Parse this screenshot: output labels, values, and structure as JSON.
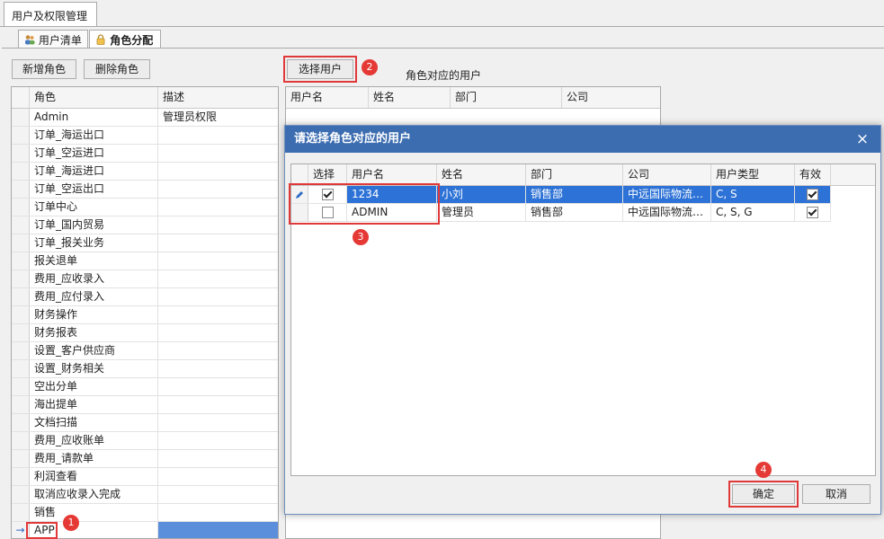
{
  "window": {
    "tab_title": "用户及权限管理"
  },
  "subtabs": [
    {
      "label": "用户清单",
      "icon": "users-icon"
    },
    {
      "label": "角色分配",
      "icon": "lock-icon"
    }
  ],
  "left": {
    "add_role": "新增角色",
    "delete_role": "删除角色",
    "columns": [
      "角色",
      "描述"
    ],
    "roles": [
      {
        "name": "Admin",
        "desc": "管理员权限"
      },
      {
        "name": "订单_海运出口",
        "desc": ""
      },
      {
        "name": "订单_空运进口",
        "desc": ""
      },
      {
        "name": "订单_海运进口",
        "desc": ""
      },
      {
        "name": "订单_空运出口",
        "desc": ""
      },
      {
        "name": "订单中心",
        "desc": ""
      },
      {
        "name": "订单_国内贸易",
        "desc": ""
      },
      {
        "name": "订单_报关业务",
        "desc": ""
      },
      {
        "name": "报关退单",
        "desc": ""
      },
      {
        "name": "费用_应收录入",
        "desc": ""
      },
      {
        "name": "费用_应付录入",
        "desc": ""
      },
      {
        "name": "财务操作",
        "desc": ""
      },
      {
        "name": "财务报表",
        "desc": ""
      },
      {
        "name": "设置_客户供应商",
        "desc": ""
      },
      {
        "name": "设置_财务相关",
        "desc": ""
      },
      {
        "name": "空出分单",
        "desc": ""
      },
      {
        "name": "海出提单",
        "desc": ""
      },
      {
        "name": "文档扫描",
        "desc": ""
      },
      {
        "name": "费用_应收账单",
        "desc": ""
      },
      {
        "name": "费用_请款单",
        "desc": ""
      },
      {
        "name": "利润查看",
        "desc": ""
      },
      {
        "name": "取消应收录入完成",
        "desc": ""
      },
      {
        "name": "销售",
        "desc": ""
      },
      {
        "name": "APP",
        "desc": ""
      }
    ],
    "current_row_marker": "→"
  },
  "right": {
    "select_user": "选择用户",
    "role_users_label": "角色对应的用户",
    "columns": [
      "用户名",
      "姓名",
      "部门",
      "公司"
    ]
  },
  "dialog": {
    "title": "请选择角色对应的用户",
    "close": "×",
    "columns": [
      "选择",
      "用户名",
      "姓名",
      "部门",
      "公司",
      "用户类型",
      "有效"
    ],
    "rows": [
      {
        "selected": true,
        "username": "1234",
        "name": "小刘",
        "dept": "销售部",
        "company": "中远国际物流…",
        "type": "C, S",
        "valid": true
      },
      {
        "selected": false,
        "username": "ADMIN",
        "name": "管理员",
        "dept": "销售部",
        "company": "中远国际物流…",
        "type": "C, S, G",
        "valid": true
      }
    ],
    "ok": "确定",
    "cancel": "取消"
  },
  "badges": [
    "1",
    "2",
    "3",
    "4"
  ],
  "colors": {
    "accent": "#3c6db0",
    "highlight_box": "#e0393a",
    "selection": "#2d72d6",
    "badge": "#e53935"
  }
}
